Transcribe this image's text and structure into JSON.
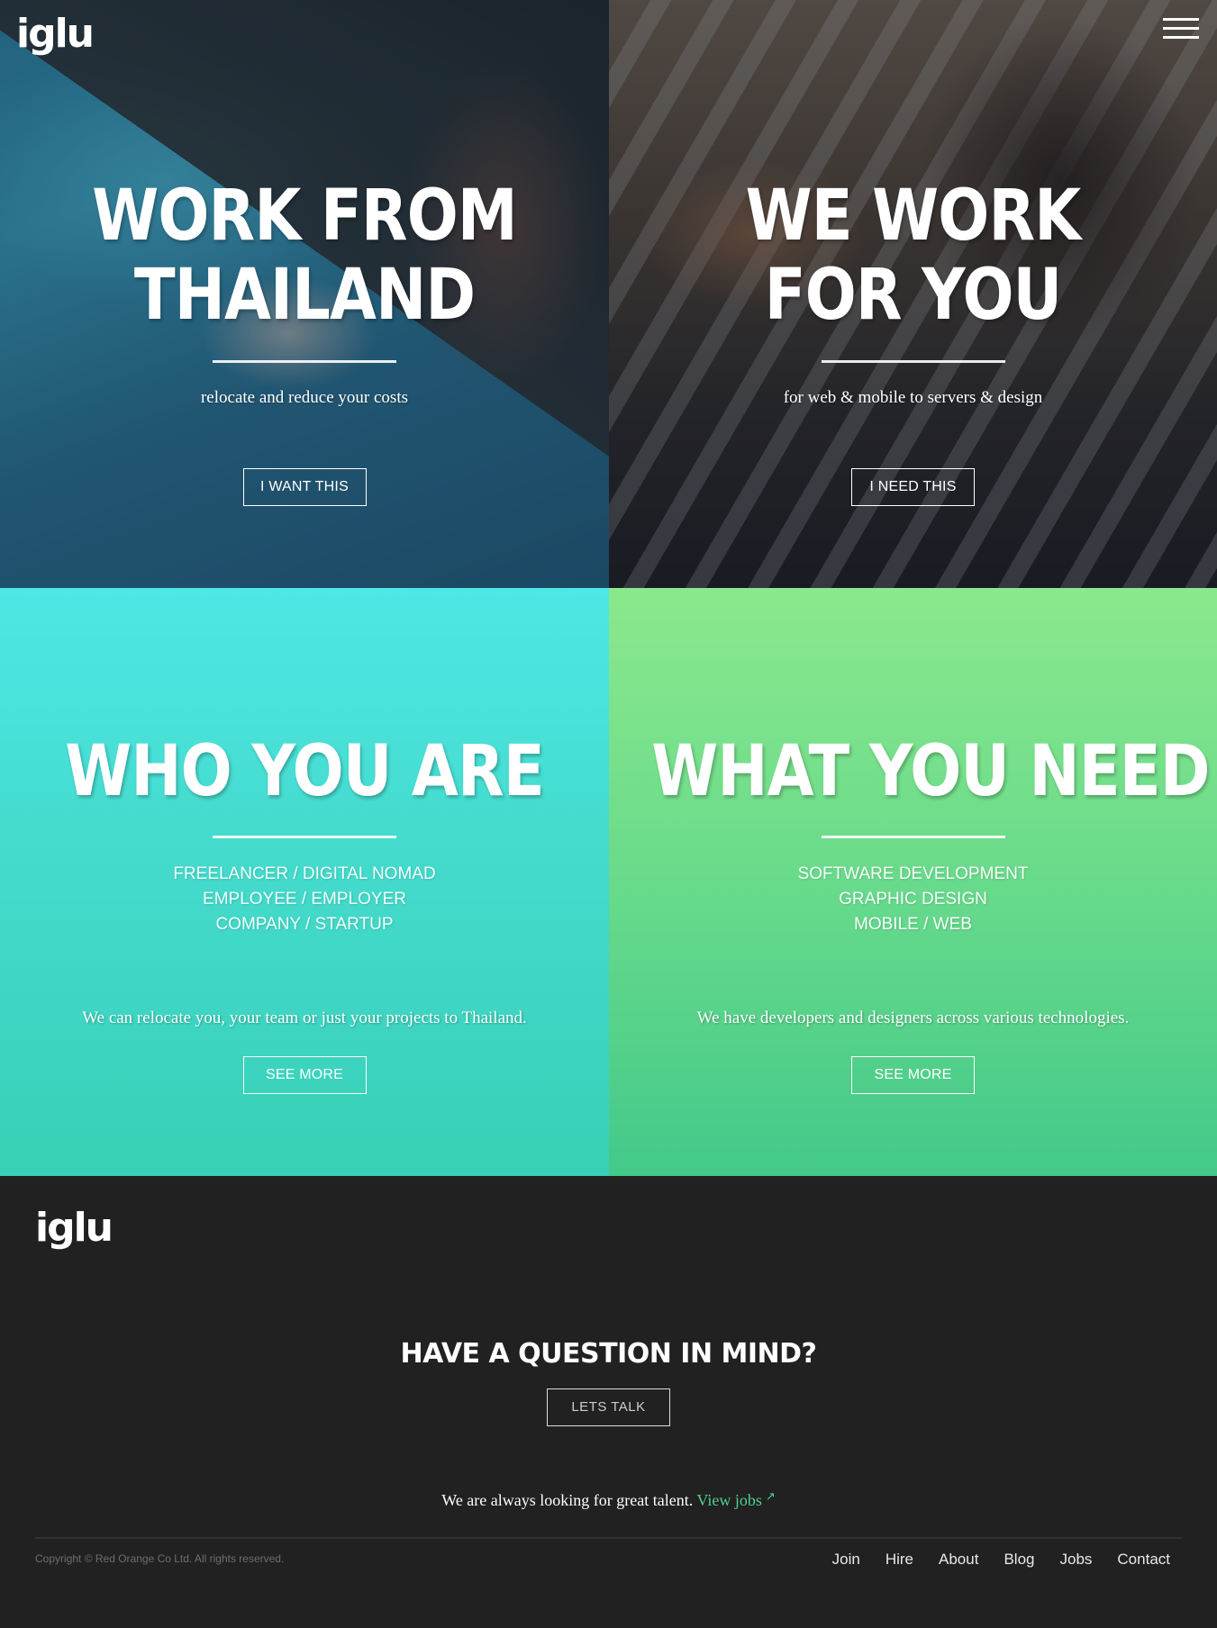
{
  "header": {
    "logo": "iglu",
    "menu_icon": "hamburger-menu-icon"
  },
  "panels": {
    "work_from_thailand": {
      "title_line1": "WORK FROM",
      "title_line2": "THAILAND",
      "subtitle": "relocate and reduce your costs",
      "button": "I WANT THIS"
    },
    "we_work_for_you": {
      "title_line1": "WE WORK",
      "title_line2": "FOR YOU",
      "subtitle": "for web & mobile to servers & design",
      "button": "I NEED THIS"
    },
    "who_you_are": {
      "title": "WHO YOU ARE",
      "list": [
        "FREELANCER / DIGITAL NOMAD",
        "EMPLOYEE / EMPLOYER",
        "COMPANY / STARTUP"
      ],
      "description": "We can relocate you, your team or just your projects to Thailand.",
      "button": "SEE MORE",
      "color": "#45dccf"
    },
    "what_you_need": {
      "title": "WHAT YOU NEED",
      "list": [
        "SOFTWARE DEVELOPMENT",
        "GRAPHIC DESIGN",
        "MOBILE / WEB"
      ],
      "description": "We have developers and designers across various technologies.",
      "button": "SEE MORE",
      "color": "#6cdc8b"
    }
  },
  "footer": {
    "logo": "iglu",
    "question": "HAVE A QUESTION IN MIND?",
    "talk_button": "LETS TALK",
    "talent_text": "We are always looking for great talent.",
    "jobs_link": "View jobs",
    "jobs_icon": "arrow-up-right-icon",
    "copyright": "Copyright © Red Orange Co Ltd. All rights reserved.",
    "nav": [
      "Join",
      "Hire",
      "About",
      "Blog",
      "Jobs",
      "Contact"
    ],
    "accent": "#4fd091"
  }
}
